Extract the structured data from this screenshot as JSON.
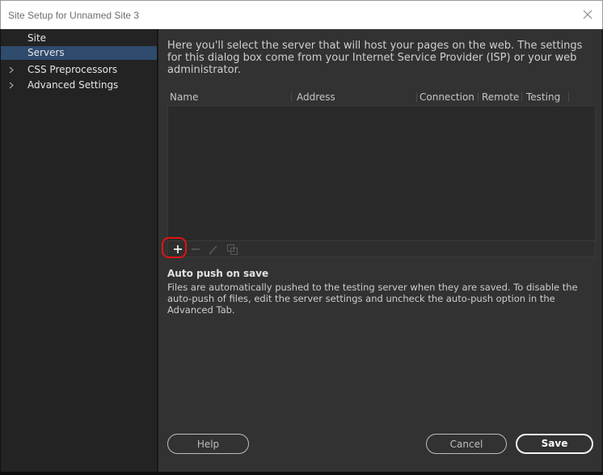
{
  "window": {
    "title": "Site Setup for Unnamed Site 3"
  },
  "sidebar": {
    "items": [
      {
        "label": "Site"
      },
      {
        "label": "Servers"
      },
      {
        "label": "CSS Preprocessors"
      },
      {
        "label": "Advanced Settings"
      }
    ]
  },
  "main": {
    "intro": "Here you'll select the server that will host your pages on the web. The settings for this dialog box come from your Internet Service Provider (ISP) or your web administrator.",
    "columns": [
      "Name",
      "Address",
      "Connection",
      "Remote",
      "Testing"
    ],
    "toolbar_icons": [
      "add-server",
      "remove-server",
      "edit-server",
      "duplicate-server"
    ],
    "auto_push": {
      "title": "Auto push on save",
      "description": "Files are automatically pushed to the testing server when they are saved. To disable the auto-push of files, edit the server settings and uncheck the auto-push option in the Advanced Tab."
    }
  },
  "buttons": {
    "help": "Help",
    "cancel": "Cancel",
    "save": "Save"
  },
  "colors": {
    "selected": "#2f4b6d",
    "highlight": "#e01414"
  }
}
